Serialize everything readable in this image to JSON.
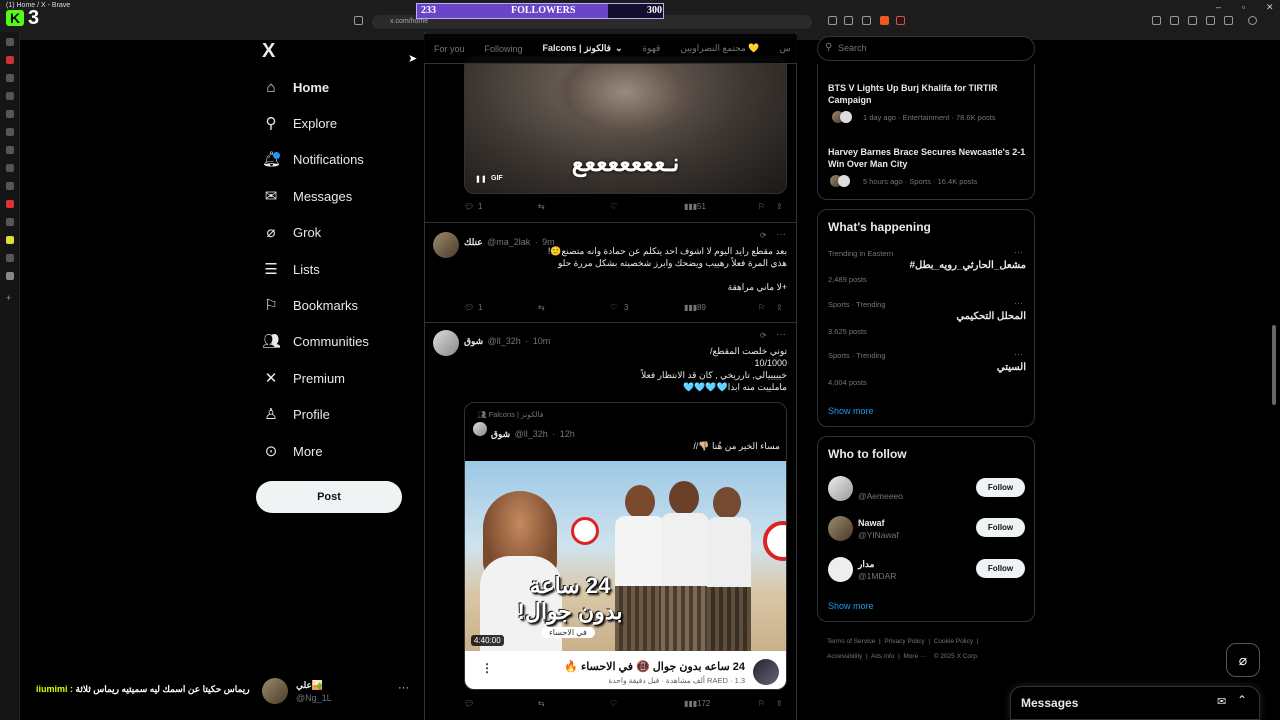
{
  "browser": {
    "tab_title": "(1) Home / X - Brave",
    "url": "x.com/home",
    "kick_logo": "K",
    "kick_number": "3"
  },
  "followers_widget": {
    "left": "233",
    "label": "FOLLOWERS",
    "right": "300",
    "progress": 0.777
  },
  "nav": {
    "logo": "X",
    "items": [
      {
        "label": "Home",
        "icon": "home-icon"
      },
      {
        "label": "Explore",
        "icon": "search-icon"
      },
      {
        "label": "Notifications",
        "icon": "bell-icon"
      },
      {
        "label": "Messages",
        "icon": "envelope-icon"
      },
      {
        "label": "Grok",
        "icon": "grok-icon"
      },
      {
        "label": "Lists",
        "icon": "list-icon"
      },
      {
        "label": "Bookmarks",
        "icon": "bookmark-icon"
      },
      {
        "label": "Communities",
        "icon": "people-icon"
      },
      {
        "label": "Premium",
        "icon": "x-icon"
      },
      {
        "label": "Profile",
        "icon": "person-icon"
      },
      {
        "label": "More",
        "icon": "more-circle-icon"
      }
    ],
    "post_label": "Post",
    "account": {
      "name": "علي🏜️",
      "handle": "@Ng_1L"
    }
  },
  "chat_overlay": {
    "user": "iiumimi :",
    "text": "ريماس حكيتا عن اسمك ليه سميتيه ريماس ثلاثة"
  },
  "tabs": [
    "For you",
    "Following",
    "Falcons | فالكونز",
    "قهوة",
    "مجتمع النصراويين 💛",
    "س"
  ],
  "tweets": {
    "t1": {
      "gif_text": "نـعععععععع",
      "gif_badge": "GIF",
      "replies": "1",
      "views": "51"
    },
    "t2": {
      "name": "عنلك",
      "handle": "@ma_2lak",
      "time": "9m",
      "lines": [
        "بعد مقطع رايد اليوم لا اشوف احد يتكلم عن حمادة وانه متصنع🙂!",
        "هذي المرة فعلاً رهييب ويضحك وابرز شخصيته بشكل مررة حلو",
        "",
        "+لا ماني مراهقة"
      ],
      "replies": "1",
      "likes": "3",
      "views": "89"
    },
    "t3": {
      "name": "شوق",
      "handle": "@ll_32h",
      "time": "10m",
      "lines": [
        "توني خلصت المقطع/",
        "10/1000",
        "خيييييالي, تارريخي , كان قد الانتظار فعلاً",
        "ماملييت منه ابدا🩵🩵🩵🩵"
      ],
      "quote": {
        "community": "Falcons | فالكونز",
        "name": "شوق",
        "handle": "@ll_32h",
        "time": "12h",
        "text": "مساء الخير من هُنا 👎🏼//",
        "thumb_title": "24 ساعة بدون جوال!",
        "thumb_sub": "في الاحساء",
        "duration": "4:40:00",
        "video_title": "24 ساعه بدون جوال 📵 في الاحساء 🔥",
        "channel": "RAED",
        "video_meta": "1.3 ألف مشاهدة · قبل دقيقة واحدة"
      },
      "views": "172"
    }
  },
  "right": {
    "search_placeholder": "Search",
    "news": [
      {
        "title": "BTS V Lights Up Burj Khalifa for TIRTIR Campaign",
        "meta": "1 day ago · Entertainment · 78.6K posts"
      },
      {
        "title": "Harvey Barnes Brace Secures Newcastle's 2-1 Win Over Man City",
        "meta": "5 hours ago · Sports · 16.4K posts"
      }
    ],
    "happening_title": "What's happening",
    "trends": [
      {
        "context": "Trending in Eastern",
        "name": "#مشعل_الحارثي_رويه_بطل",
        "posts": "2,489 posts"
      },
      {
        "context": "Sports · Trending",
        "name": "المحلل التحكيمي",
        "posts": "3,625 posts"
      },
      {
        "context": "Sports · Trending",
        "name": "السيتي",
        "posts": "4,004 posts"
      }
    ],
    "show_more": "Show more",
    "wtf_title": "Who to follow",
    "follow": [
      {
        "name": "",
        "handle": "@Aemeeeo"
      },
      {
        "name": "Nawaf",
        "handle": "@YINawaf"
      },
      {
        "name": "مدار",
        "handle": "@1MDAR"
      }
    ],
    "follow_label": "Follow",
    "footer_links": [
      "Terms of Service",
      "Privacy Policy",
      "Cookie Policy",
      "Accessibility",
      "Ads info",
      "More ···",
      "© 2025 X Corp."
    ],
    "messages_title": "Messages"
  }
}
